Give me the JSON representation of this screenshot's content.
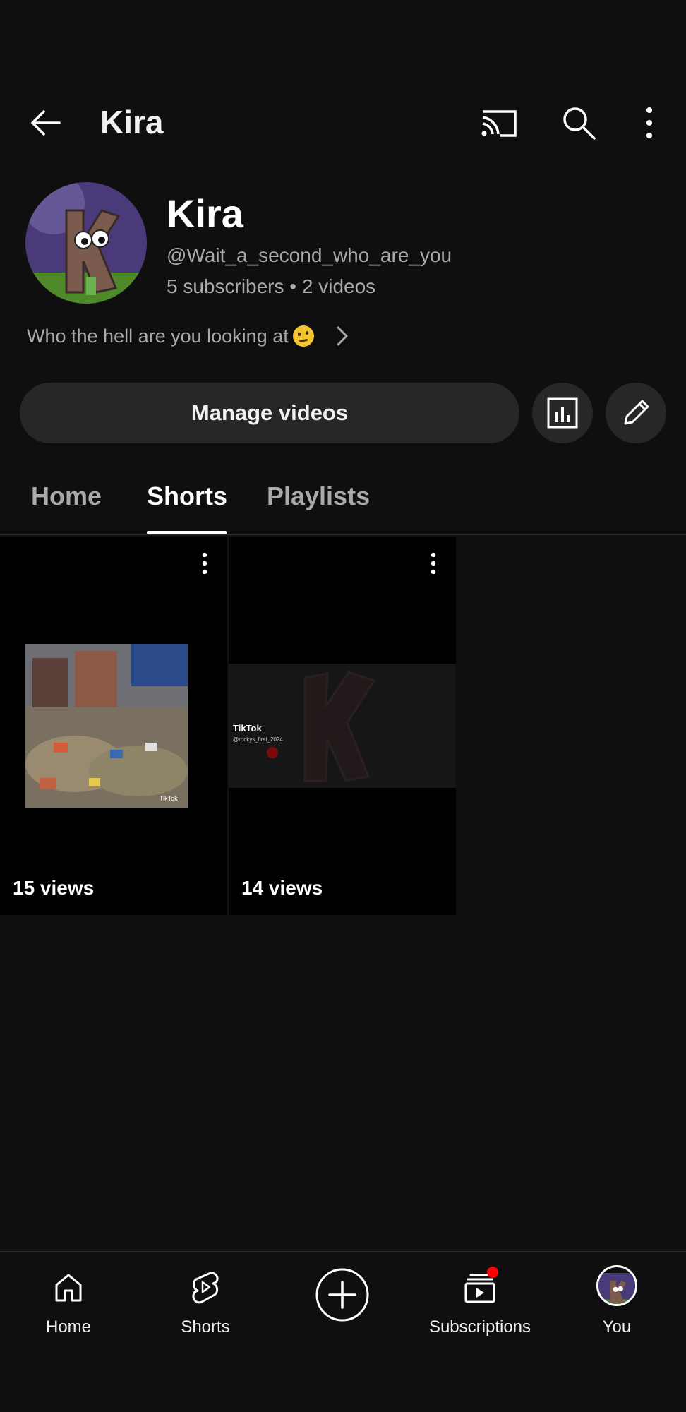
{
  "header": {
    "title": "Kira",
    "back_icon": "arrow-back-icon",
    "cast_icon": "cast-icon",
    "search_icon": "search-icon",
    "more_icon": "more-vert-icon"
  },
  "channel": {
    "name": "Kira",
    "handle": "@Wait_a_second_who_are_you",
    "stats": "5 subscribers • 2 videos",
    "description": "Who the hell are you looking at"
  },
  "actions": {
    "manage_videos": "Manage videos",
    "analytics_icon": "analytics-icon",
    "edit_icon": "pencil-icon"
  },
  "tabs": [
    {
      "label": "Home",
      "active": false
    },
    {
      "label": "Shorts",
      "active": true
    },
    {
      "label": "Playlists",
      "active": false
    }
  ],
  "shorts": [
    {
      "views": "15 views",
      "watermark": "TikTok"
    },
    {
      "views": "14 views",
      "watermark": "TikTok",
      "watermark_user": "@rockys_first_2024"
    }
  ],
  "bottom_nav": [
    {
      "label": "Home",
      "icon": "home-icon"
    },
    {
      "label": "Shorts",
      "icon": "shorts-icon"
    },
    {
      "label": "",
      "icon": "create-plus-icon"
    },
    {
      "label": "Subscriptions",
      "icon": "subscriptions-icon",
      "has_notification": true
    },
    {
      "label": "You",
      "icon": "avatar"
    }
  ],
  "colors": {
    "background": "#0f0f0f",
    "button_bg": "#272727",
    "secondary_text": "#aaaaaa",
    "notification": "#ff0000"
  }
}
